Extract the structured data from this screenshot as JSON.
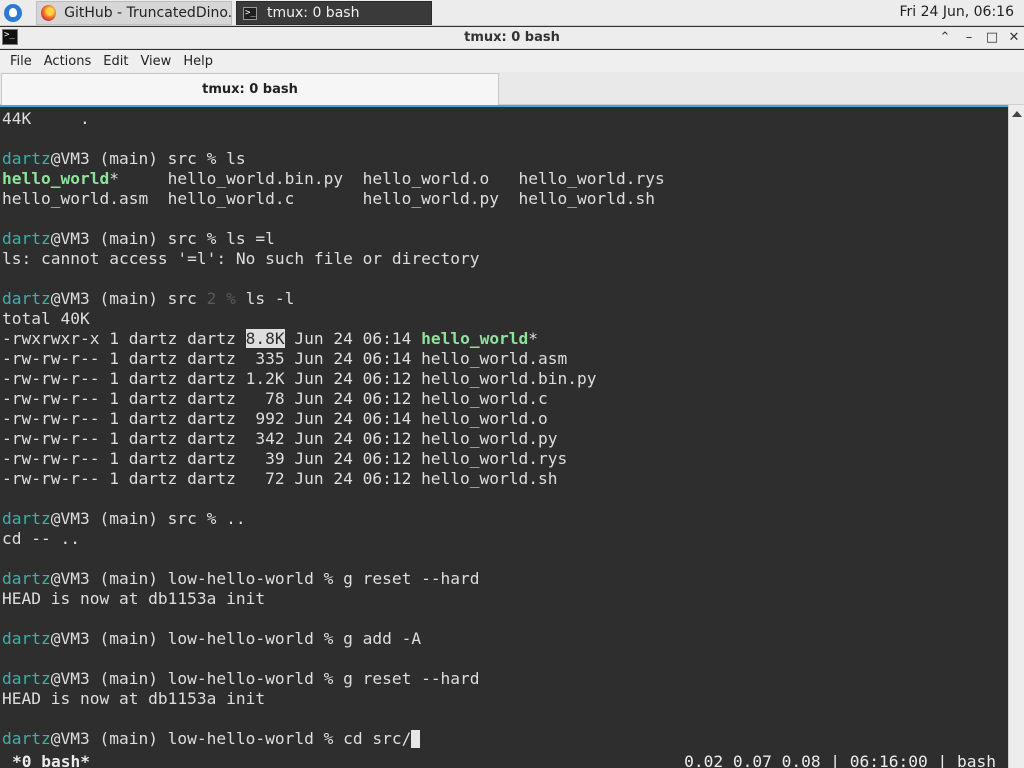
{
  "panel": {
    "tasks": [
      {
        "label": "GitHub - TruncatedDino...",
        "icon": "firefox-icon"
      },
      {
        "label": "tmux: 0 bash",
        "icon": "terminal-icon"
      }
    ],
    "clock": "Fri 24 Jun, 06:16"
  },
  "window": {
    "title": "tmux: 0 bash",
    "controls": {
      "minimize": "⌃",
      "restore": "–",
      "maximize": "□",
      "close": "✕"
    }
  },
  "menu": [
    "File",
    "Actions",
    "Edit",
    "View",
    "Help"
  ],
  "tab": {
    "label": "tmux: 0 bash"
  },
  "prompt": {
    "user": "dartz",
    "host_part": "@VM3 (main) "
  },
  "terminal_lines": [
    [
      {
        "t": "44K     ."
      }
    ],
    [
      {
        "t": ""
      }
    ],
    [
      {
        "t": "dartz",
        "c": "u"
      },
      {
        "t": "@VM3 (main) src % ls"
      }
    ],
    [
      {
        "t": "hello_world",
        "c": "exe"
      },
      {
        "t": "*     hello_world.bin.py  hello_world.o   hello_world.rys"
      }
    ],
    [
      {
        "t": "hello_world.asm  hello_world.c       hello_world.py  hello_world.sh"
      }
    ],
    [
      {
        "t": ""
      }
    ],
    [
      {
        "t": "dartz",
        "c": "u"
      },
      {
        "t": "@VM3 (main) src % ls =l"
      }
    ],
    [
      {
        "t": "ls: cannot access '=l': No such file or directory"
      }
    ],
    [
      {
        "t": ""
      }
    ],
    [
      {
        "t": "dartz",
        "c": "u"
      },
      {
        "t": "@VM3 (main) src "
      },
      {
        "t": "2 %",
        "c": "dim"
      },
      {
        "t": " ls -l"
      }
    ],
    [
      {
        "t": "total 40K"
      }
    ],
    [
      {
        "t": "-rwxrwxr-x 1 dartz dartz "
      },
      {
        "t": "8.8K",
        "c": "hl"
      },
      {
        "t": " Jun 24 06:14 "
      },
      {
        "t": "hello_world",
        "c": "exe"
      },
      {
        "t": "*"
      }
    ],
    [
      {
        "t": "-rw-rw-r-- 1 dartz dartz  335 Jun 24 06:14 hello_world.asm"
      }
    ],
    [
      {
        "t": "-rw-rw-r-- 1 dartz dartz 1.2K Jun 24 06:12 hello_world.bin.py"
      }
    ],
    [
      {
        "t": "-rw-rw-r-- 1 dartz dartz   78 Jun 24 06:12 hello_world.c"
      }
    ],
    [
      {
        "t": "-rw-rw-r-- 1 dartz dartz  992 Jun 24 06:14 hello_world.o"
      }
    ],
    [
      {
        "t": "-rw-rw-r-- 1 dartz dartz  342 Jun 24 06:12 hello_world.py"
      }
    ],
    [
      {
        "t": "-rw-rw-r-- 1 dartz dartz   39 Jun 24 06:12 hello_world.rys"
      }
    ],
    [
      {
        "t": "-rw-rw-r-- 1 dartz dartz   72 Jun 24 06:12 hello_world.sh"
      }
    ],
    [
      {
        "t": ""
      }
    ],
    [
      {
        "t": "dartz",
        "c": "u"
      },
      {
        "t": "@VM3 (main) src % .."
      }
    ],
    [
      {
        "t": "cd -- .."
      }
    ],
    [
      {
        "t": ""
      }
    ],
    [
      {
        "t": "dartz",
        "c": "u"
      },
      {
        "t": "@VM3 (main) low-hello-world % g reset --hard"
      }
    ],
    [
      {
        "t": "HEAD is now at db1153a init"
      }
    ],
    [
      {
        "t": ""
      }
    ],
    [
      {
        "t": "dartz",
        "c": "u"
      },
      {
        "t": "@VM3 (main) low-hello-world % g add -A"
      }
    ],
    [
      {
        "t": ""
      }
    ],
    [
      {
        "t": "dartz",
        "c": "u"
      },
      {
        "t": "@VM3 (main) low-hello-world % g reset --hard"
      }
    ],
    [
      {
        "t": "HEAD is now at db1153a init"
      }
    ],
    [
      {
        "t": ""
      }
    ],
    [
      {
        "t": "dartz",
        "c": "u"
      },
      {
        "t": "@VM3 (main) low-hello-world % cd src/"
      },
      {
        "cursor": true
      }
    ]
  ],
  "status": {
    "left": "*0 bash*",
    "right": "0.02 0.07 0.08 | 06:16:00 | bash"
  }
}
